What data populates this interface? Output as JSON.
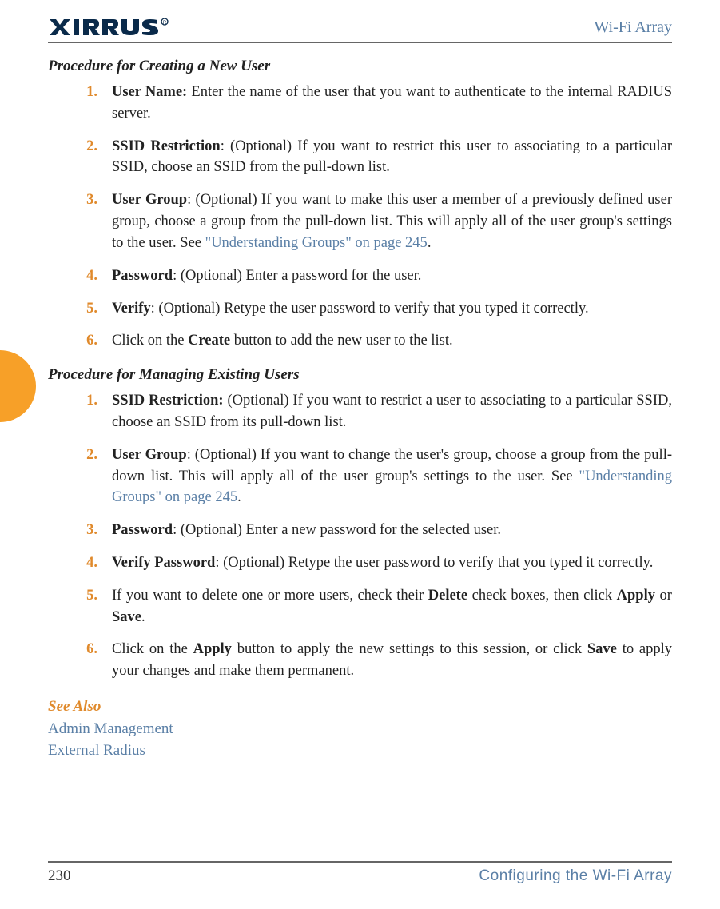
{
  "header": {
    "brand": "XIRRUS",
    "right": "Wi-Fi Array"
  },
  "section1_heading": "Procedure for Creating a New User",
  "section1": {
    "s1": {
      "num": "1.",
      "label": "User Name:",
      "text": " Enter the name of the user that you want to authenticate to the internal RADIUS server."
    },
    "s2": {
      "num": "2.",
      "label": "SSID Restriction",
      "text": ": (Optional) If you want to restrict this user to associating to a particular SSID, choose an SSID from the pull-down list."
    },
    "s3": {
      "num": "3.",
      "label": "User Group",
      "text_a": ": (Optional) If you want to make this user a member of a previously defined user group, choose a group from the pull-down list. This will apply all of the user group's settings to the user. See ",
      "xref": "\"Understanding Groups\" on page 245",
      "text_b": "."
    },
    "s4": {
      "num": "4.",
      "label": "Password",
      "text": ": (Optional) Enter a password for the user."
    },
    "s5": {
      "num": "5.",
      "label": "Verify",
      "text": ": (Optional) Retype the user password to verify that you typed it correctly."
    },
    "s6": {
      "num": "6.",
      "text_a": "Click on the ",
      "bold": "Create",
      "text_b": " button to add the new user to the list."
    }
  },
  "section2_heading": "Procedure for Managing Existing Users",
  "section2": {
    "s1": {
      "num": "1.",
      "label": "SSID Restriction:",
      "text": " (Optional) If you want to restrict a user to associating to a particular SSID, choose an SSID from its pull-down list."
    },
    "s2": {
      "num": "2.",
      "label": "User Group",
      "text_a": ": (Optional) If you want to change the user's group, choose a group from the pull-down list. This will apply all of the user group's settings to the user. See ",
      "xref": "\"Understanding Groups\" on page 245",
      "text_b": "."
    },
    "s3": {
      "num": "3.",
      "label": "Password",
      "text": ": (Optional) Enter a new password for the selected user."
    },
    "s4": {
      "num": "4.",
      "label": "Verify Password",
      "text": ": (Optional) Retype the user password to verify that you typed it correctly."
    },
    "s5": {
      "num": "5.",
      "text_a": "If you want to delete one or more users, check their ",
      "bold1": "Delete",
      "text_b": " check boxes, then click ",
      "bold2": "Apply",
      "text_c": " or ",
      "bold3": "Save",
      "text_d": "."
    },
    "s6": {
      "num": "6.",
      "text_a": "Click on the ",
      "bold1": "Apply",
      "text_b": " button to apply the new settings to this session, or click ",
      "bold2": "Save",
      "text_c": " to apply your changes and make them permanent."
    }
  },
  "see_also": {
    "heading": "See Also",
    "links": {
      "l1": "Admin Management",
      "l2": "External Radius"
    }
  },
  "footer": {
    "page": "230",
    "section": "Configuring the Wi-Fi Array"
  }
}
